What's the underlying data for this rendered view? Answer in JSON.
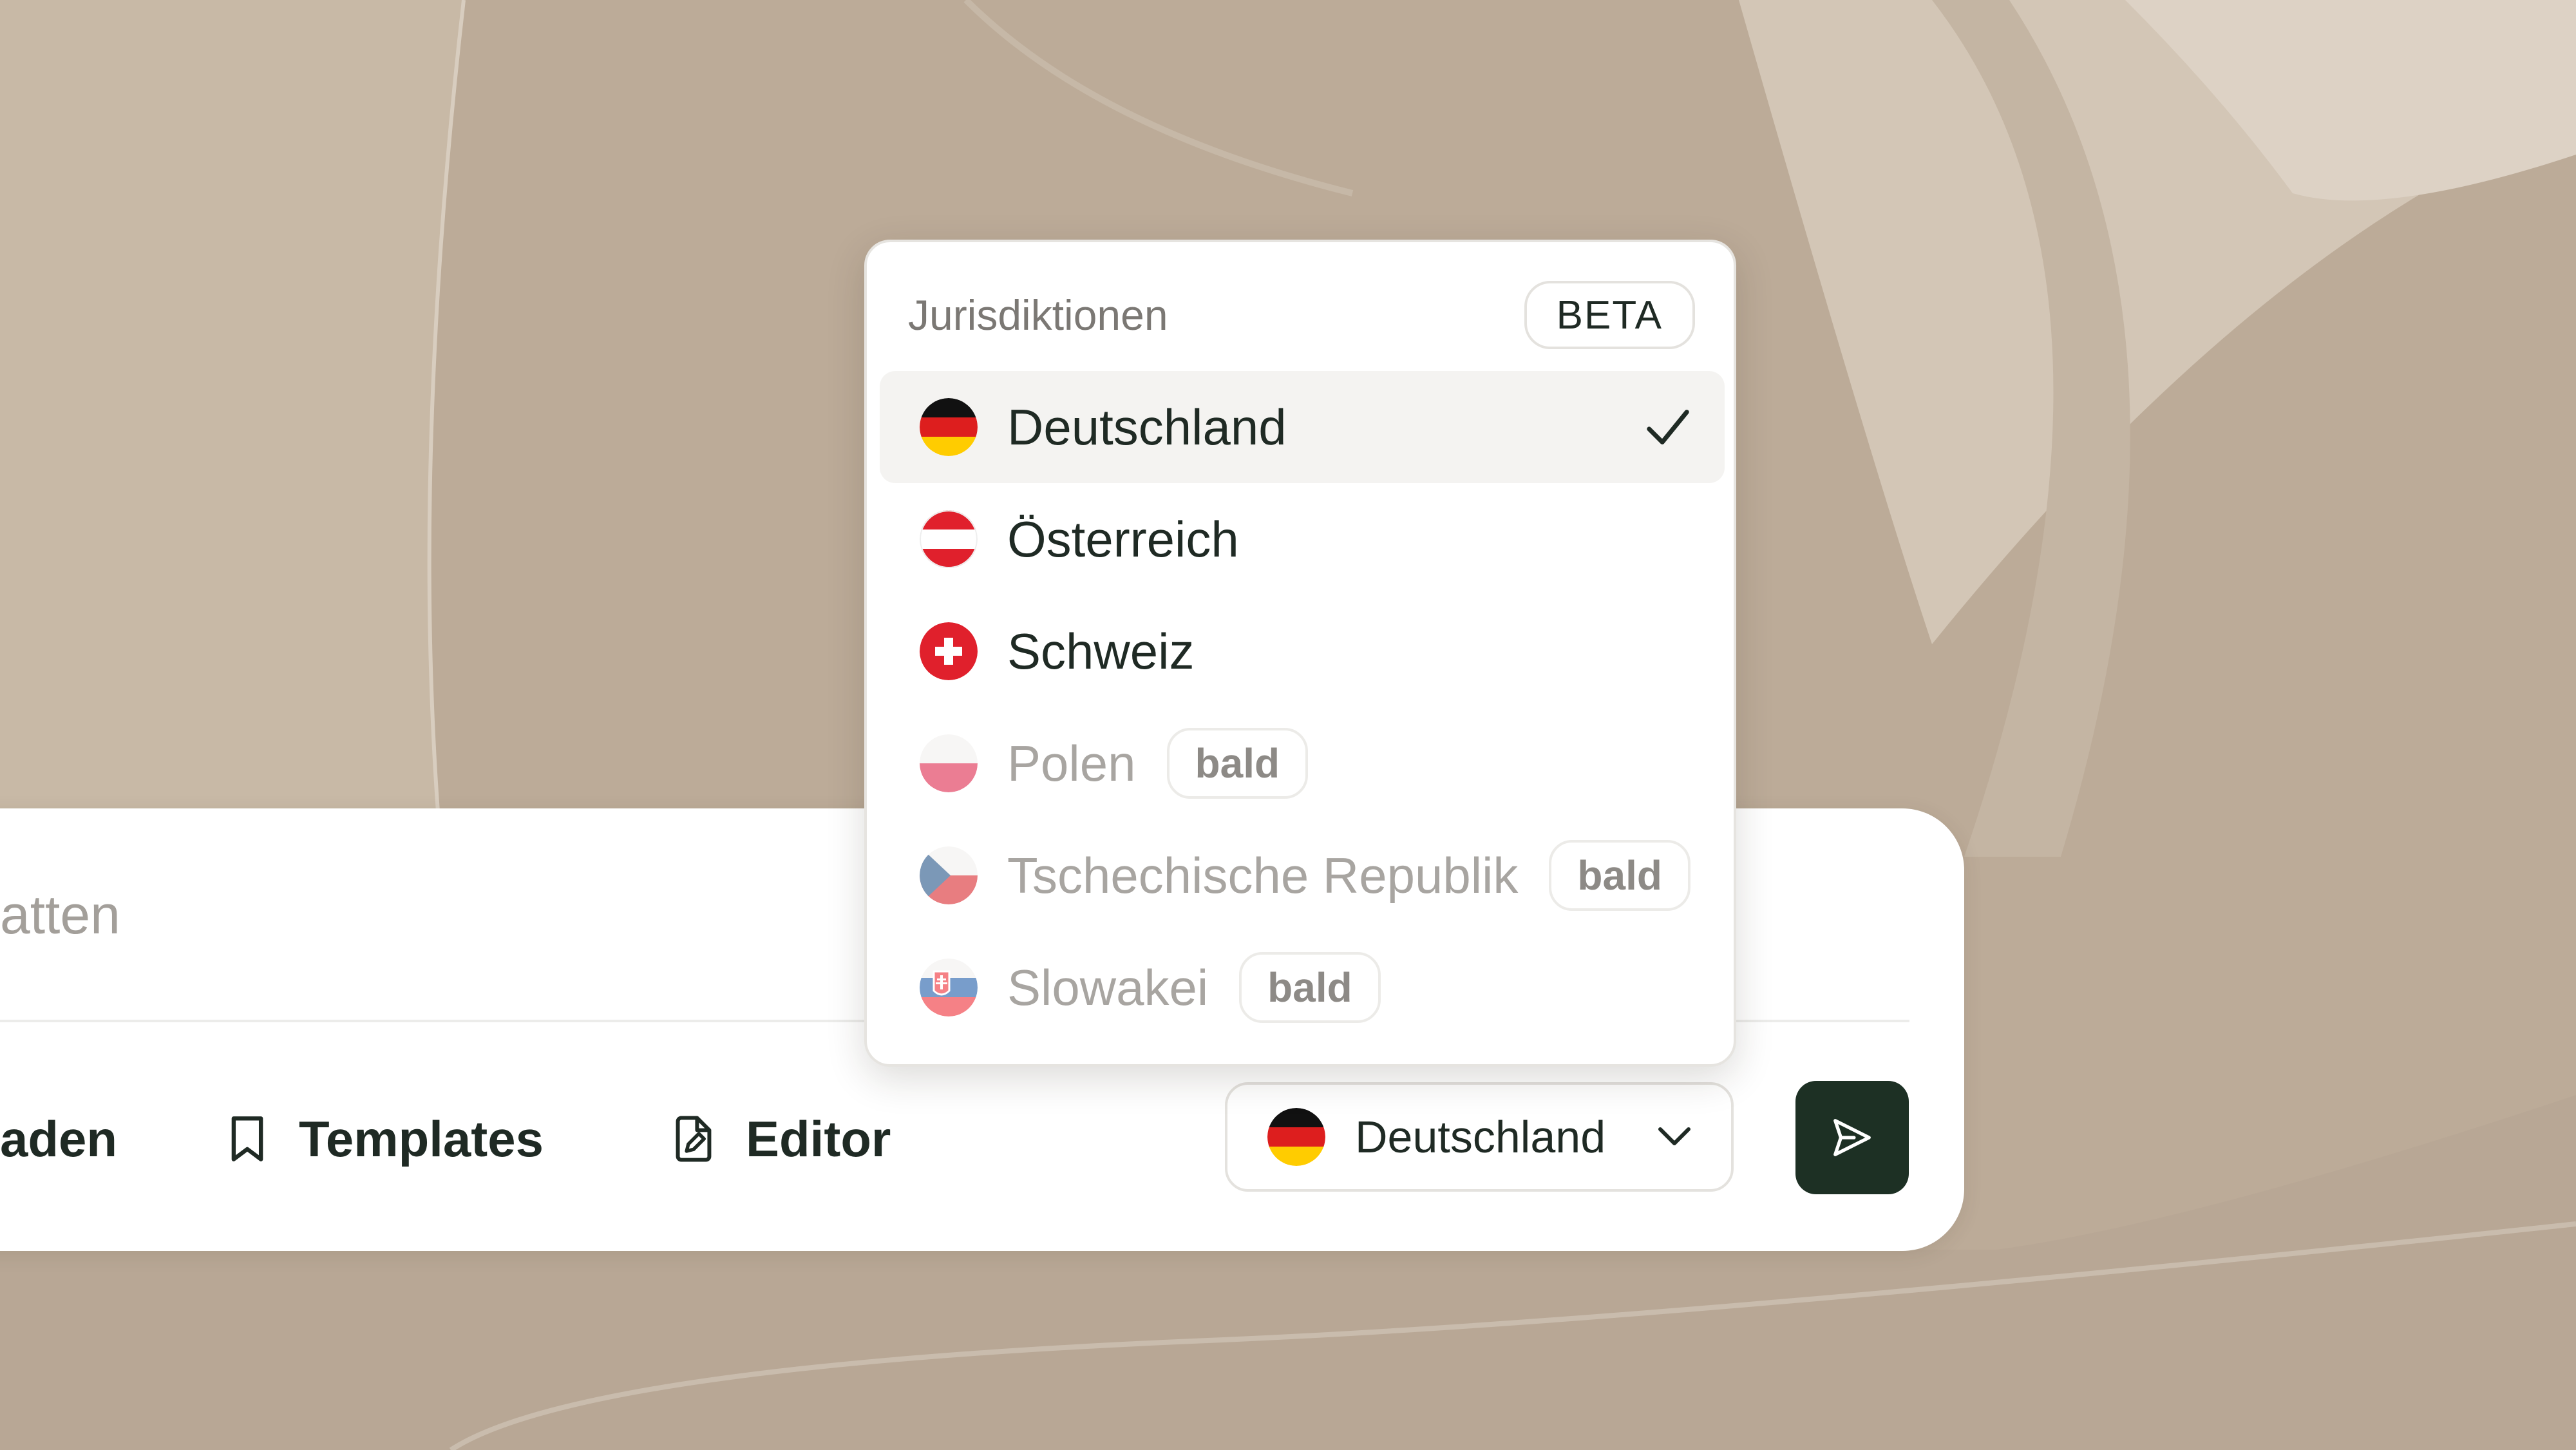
{
  "composer": {
    "input_text": "atten",
    "toolbar": [
      {
        "label": "aden",
        "icon": "upload-icon"
      },
      {
        "label": "Templates",
        "icon": "bookmark-icon"
      },
      {
        "label": "Editor",
        "icon": "file-edit-icon"
      }
    ],
    "jurisdiction_select": {
      "selected": "Deutschland",
      "flag": "germany-flag-icon",
      "chevron": "chevron-down-icon"
    },
    "send_button": {
      "icon": "send-icon"
    }
  },
  "dropdown": {
    "title": "Jurisdiktionen",
    "badge": "BETA",
    "items": [
      {
        "label": "Deutschland",
        "flag": "germany-flag-icon",
        "selected": true,
        "available": true
      },
      {
        "label": "Österreich",
        "flag": "austria-flag-icon",
        "selected": false,
        "available": true
      },
      {
        "label": "Schweiz",
        "flag": "switzerland-flag-icon",
        "selected": false,
        "available": true
      },
      {
        "label": "Polen",
        "flag": "poland-flag-icon",
        "selected": false,
        "available": false,
        "badge": "bald"
      },
      {
        "label": "Tschechische Republik",
        "flag": "czech-flag-icon",
        "selected": false,
        "available": false,
        "badge": "bald"
      },
      {
        "label": "Slowakei",
        "flag": "slovakia-flag-icon",
        "selected": false,
        "available": false,
        "badge": "bald"
      }
    ]
  },
  "colors": {
    "background": "#bcab98",
    "card": "#ffffff",
    "primary_dark": "#1d3024",
    "text_dark": "#1f2a24",
    "muted": "#a8a5a1"
  }
}
